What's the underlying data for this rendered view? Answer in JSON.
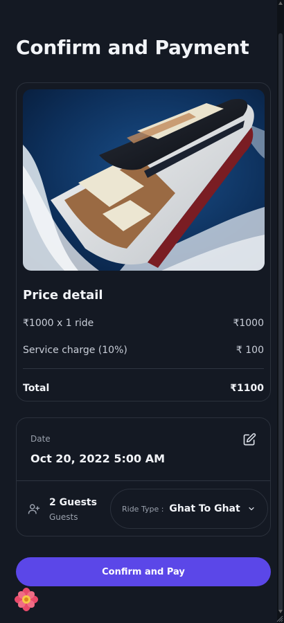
{
  "page": {
    "title": "Confirm and Payment"
  },
  "hero": {
    "icon": "yacht-image"
  },
  "price_detail": {
    "heading": "Price detail",
    "rows": [
      {
        "label": "₹1000 x 1 ride",
        "value": "₹1000"
      },
      {
        "label": "Service charge (10%)",
        "value": "₹ 100"
      }
    ],
    "total_label": "Total",
    "total_value": "₹1100"
  },
  "booking": {
    "date_label": "Date",
    "date_value": "Oct 20, 2022 5:00 AM",
    "edit_icon": "edit-icon",
    "guests_count": "2 Guests",
    "guests_label": "Guests",
    "ride_type_label": "Ride Type :",
    "ride_type_value": "Ghat To Ghat"
  },
  "actions": {
    "confirm_label": "Confirm and Pay"
  },
  "colors": {
    "background": "#141923",
    "card_border": "#2b313c",
    "accent": "#5b47e8",
    "text": "#f2f4f8",
    "muted": "#9aa1ad"
  }
}
